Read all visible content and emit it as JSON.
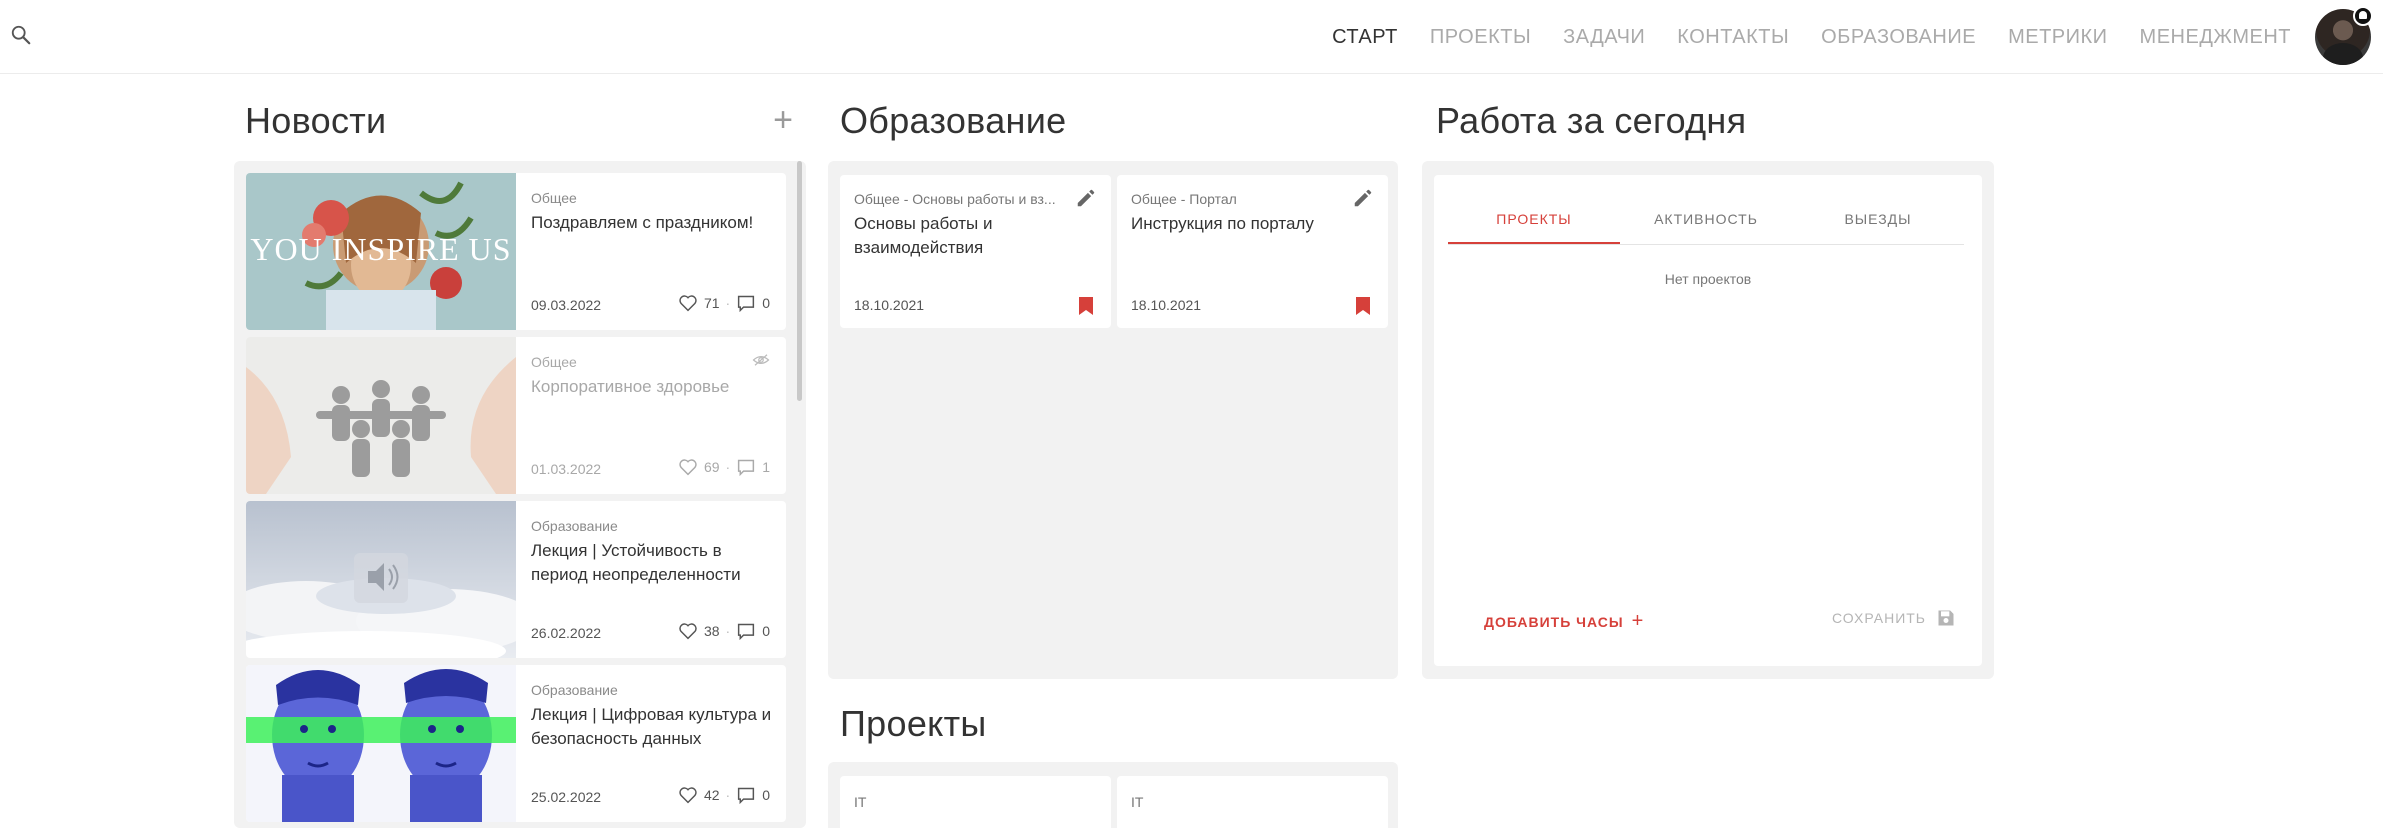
{
  "header": {
    "nav": [
      {
        "label": "СТАРТ",
        "active": true
      },
      {
        "label": "ПРОЕКТЫ",
        "active": false
      },
      {
        "label": "ЗАДАЧИ",
        "active": false
      },
      {
        "label": "КОНТАКТЫ",
        "active": false
      },
      {
        "label": "ОБРАЗОВАНИЕ",
        "active": false
      },
      {
        "label": "МЕТРИКИ",
        "active": false
      },
      {
        "label": "МЕНЕДЖМЕНТ",
        "active": false
      }
    ],
    "icons": {
      "search": "search-icon",
      "notification": "bell-icon"
    }
  },
  "news": {
    "title": "Новости",
    "add_label": "+",
    "items": [
      {
        "category": "Общее",
        "title": "Поздравляем с праздником!",
        "date": "09.03.2022",
        "likes": "71",
        "comments": "0",
        "image_text": "YOU INSPIRE US",
        "hidden": false
      },
      {
        "category": "Общее",
        "title": "Корпоративное здоровье",
        "date": "01.03.2022",
        "likes": "69",
        "comments": "1",
        "hidden": true
      },
      {
        "category": "Образование",
        "title": "Лекция | Устойчивость в период неопределенности",
        "date": "26.02.2022",
        "likes": "38",
        "comments": "0",
        "hidden": false
      },
      {
        "category": "Образование",
        "title": "Лекция | Цифровая культура и безопасность данных",
        "date": "25.02.2022",
        "likes": "42",
        "comments": "0",
        "hidden": false
      }
    ]
  },
  "education": {
    "title": "Образование",
    "items": [
      {
        "category": "Общее - Основы работы и вз...",
        "title": "Основы работы и взаимодействия",
        "date": "18.10.2021"
      },
      {
        "category": "Общее - Портал",
        "title": "Инструкция по порталу",
        "date": "18.10.2021"
      }
    ]
  },
  "projects": {
    "title": "Проекты",
    "items": [
      {
        "category": "IT"
      },
      {
        "category": "IT"
      }
    ]
  },
  "work": {
    "title": "Работа за сегодня",
    "tabs": [
      {
        "label": "ПРОЕКТЫ",
        "active": true
      },
      {
        "label": "АКТИВНОСТЬ",
        "active": false
      },
      {
        "label": "ВЫЕЗДЫ",
        "active": false
      }
    ],
    "empty_message": "Нет проектов",
    "add_hours_label": "ДОБАВИТЬ ЧАСЫ",
    "add_hours_plus": "+",
    "save_label": "СОХРАНИТЬ"
  },
  "colors": {
    "accent": "#d6403a",
    "panel_bg": "#f2f2f2",
    "muted": "#aaaaaa"
  }
}
